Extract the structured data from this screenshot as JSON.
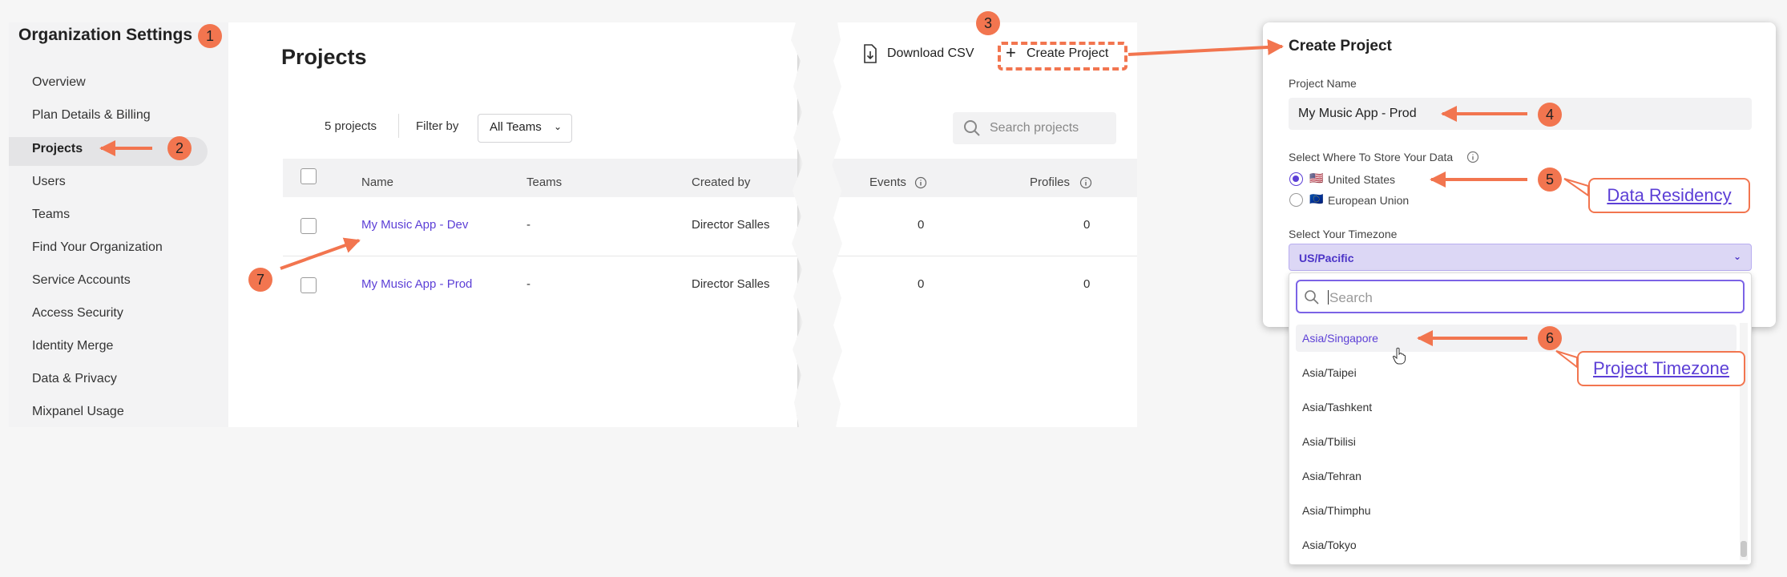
{
  "sidebar": {
    "title": "Organization Settings",
    "items": [
      {
        "label": "Overview"
      },
      {
        "label": "Plan Details & Billing"
      },
      {
        "label": "Projects"
      },
      {
        "label": "Users"
      },
      {
        "label": "Teams"
      },
      {
        "label": "Find Your Organization"
      },
      {
        "label": "Service Accounts"
      },
      {
        "label": "Access Security"
      },
      {
        "label": "Identity Merge"
      },
      {
        "label": "Data & Privacy"
      },
      {
        "label": "Mixpanel Usage"
      }
    ]
  },
  "projects": {
    "title": "Projects",
    "count": "5 projects",
    "filter_label": "Filter by",
    "filter_value": "All Teams",
    "download_csv": "Download CSV",
    "create_project": "Create Project",
    "search_placeholder": "Search projects",
    "columns": [
      "Name",
      "Teams",
      "Created by",
      "Events",
      "Profiles"
    ],
    "rows": [
      {
        "name": "My Music App - Dev",
        "teams": "-",
        "created_by": "Director Salles",
        "events": "0",
        "profiles": "0"
      },
      {
        "name": "My Music App - Prod",
        "teams": "-",
        "created_by": "Director Salles",
        "events": "0",
        "profiles": "0"
      }
    ]
  },
  "modal": {
    "title": "Create Project",
    "name_label": "Project Name",
    "name_value": "My Music App - Prod",
    "store_label": "Select Where To Store Your Data",
    "regions": [
      {
        "label": "United States",
        "flag": "🇺🇸",
        "selected": true
      },
      {
        "label": "European Union",
        "flag": "🇪🇺",
        "selected": false
      }
    ],
    "tz_label": "Select Your Timezone",
    "tz_value": "US/Pacific",
    "tz_search_placeholder": "Search",
    "tz_options": [
      "Asia/Singapore",
      "Asia/Taipei",
      "Asia/Tashkent",
      "Asia/Tbilisi",
      "Asia/Tehran",
      "Asia/Thimphu",
      "Asia/Tokyo"
    ]
  },
  "annotations": {
    "badges": [
      "1",
      "2",
      "3",
      "4",
      "5",
      "6",
      "7"
    ],
    "callouts": [
      "Data Residency",
      "Project Timezone"
    ],
    "accent_color": "#f2754f",
    "link_color": "#5c3fd6"
  }
}
